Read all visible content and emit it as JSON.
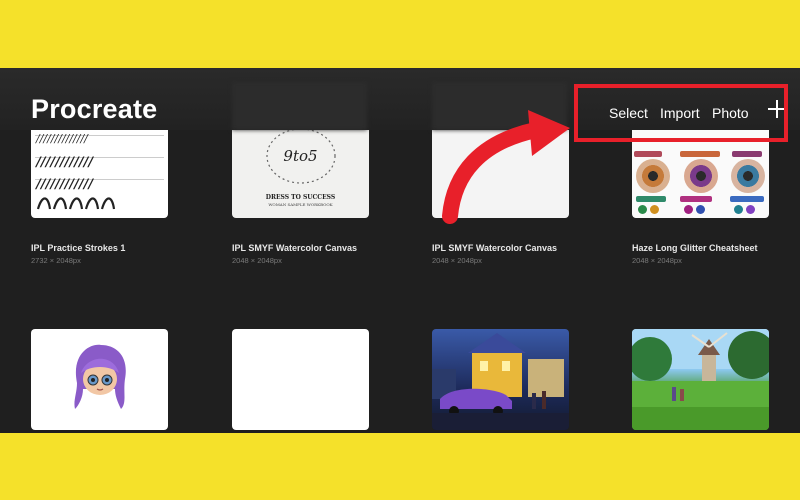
{
  "app": {
    "title": "Procreate"
  },
  "toolbar": {
    "select_label": "Select",
    "import_label": "Import",
    "photo_label": "Photo",
    "add_icon": "plus-icon"
  },
  "colors": {
    "accent": "#e8202a",
    "band": "#f5e12a",
    "background": "#1f1f1f"
  },
  "artworks": [
    {
      "title": "IPL Practice Strokes 1",
      "size": "2732 × 2048px"
    },
    {
      "title": "IPL SMYF Watercolor Canvas",
      "size": "2048 × 2048px",
      "thumb_title": "9to5",
      "thumb_line1": "DRESS TO SUCCESS",
      "thumb_line2": "WOMAN SAMPLE WORKBOOK"
    },
    {
      "title": "IPL SMYF Watercolor Canvas",
      "size": "2048 × 2048px"
    },
    {
      "title": "Haze Long Glitter Cheatsheet",
      "size": "2048 × 2048px"
    }
  ],
  "stroke_rows": [
    "//////////////",
    "////////////",
    "////////////",
    "////////////"
  ],
  "annotation": {
    "arrow_icon": "red-arrow-icon",
    "highlight": "red-highlight-box"
  }
}
